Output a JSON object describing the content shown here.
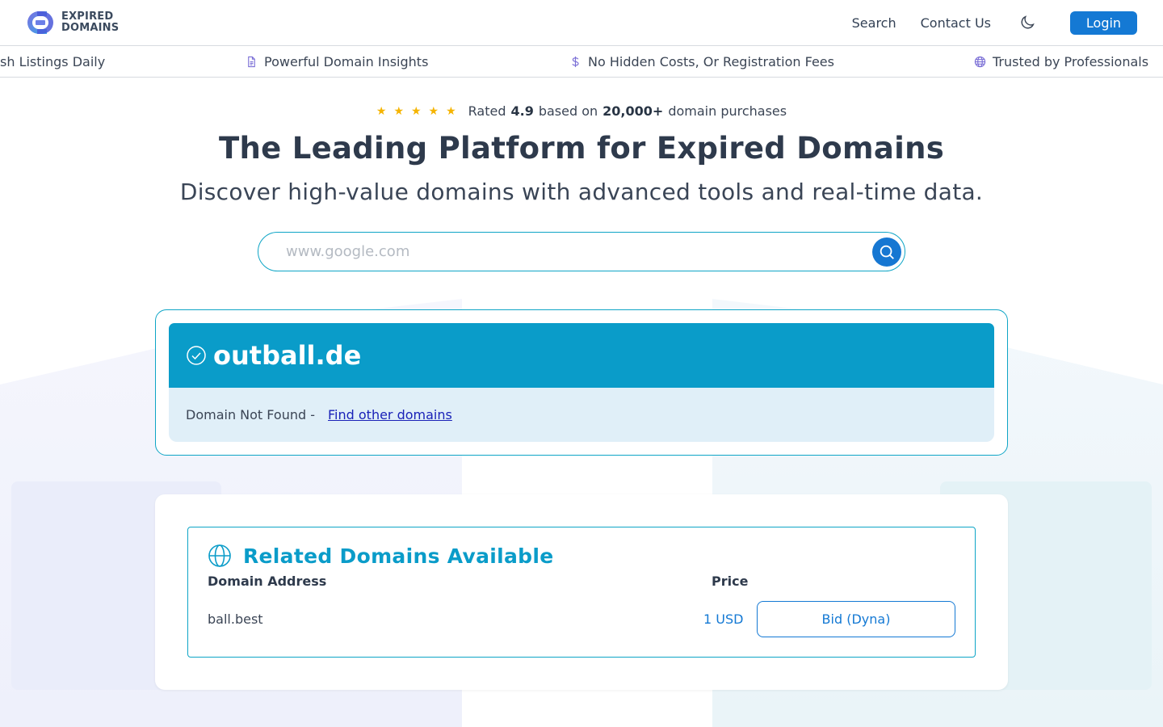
{
  "header": {
    "logo_line1": "EXPIRED",
    "logo_line2": "DOMAINS",
    "nav_search": "Search",
    "nav_contact": "Contact Us",
    "login": "Login"
  },
  "ticker": [
    {
      "icon": "refresh-icon",
      "label": "sh Listings Daily"
    },
    {
      "icon": "document-icon",
      "label": "Powerful Domain Insights"
    },
    {
      "icon": "dollar-icon",
      "label": "No Hidden Costs, Or Registration Fees"
    },
    {
      "icon": "globe-icon",
      "label": "Trusted by Professionals"
    }
  ],
  "hero": {
    "stars": "★★★★★",
    "rating_prefix": "Rated",
    "rating_value": "4.9",
    "rating_mid": "based on",
    "rating_count": "20,000+",
    "rating_suffix": "domain purchases",
    "title": "The Leading Platform for Expired Domains",
    "subtitle": "Discover high-value domains with advanced tools and real-time data."
  },
  "search": {
    "placeholder": "www.google.com",
    "value": ""
  },
  "result": {
    "domain": "outball.de",
    "status": "Domain Not Found -",
    "link": "Find other domains"
  },
  "related": {
    "title": "Related Domains Available",
    "col_domain": "Domain Address",
    "col_price": "Price",
    "rows": [
      {
        "domain": "ball.best",
        "price": "1 USD",
        "action": "Bid (Dyna)"
      }
    ]
  },
  "colors": {
    "accent": "#0a9cc9",
    "primary": "#1479d4",
    "star": "#f5b400"
  }
}
